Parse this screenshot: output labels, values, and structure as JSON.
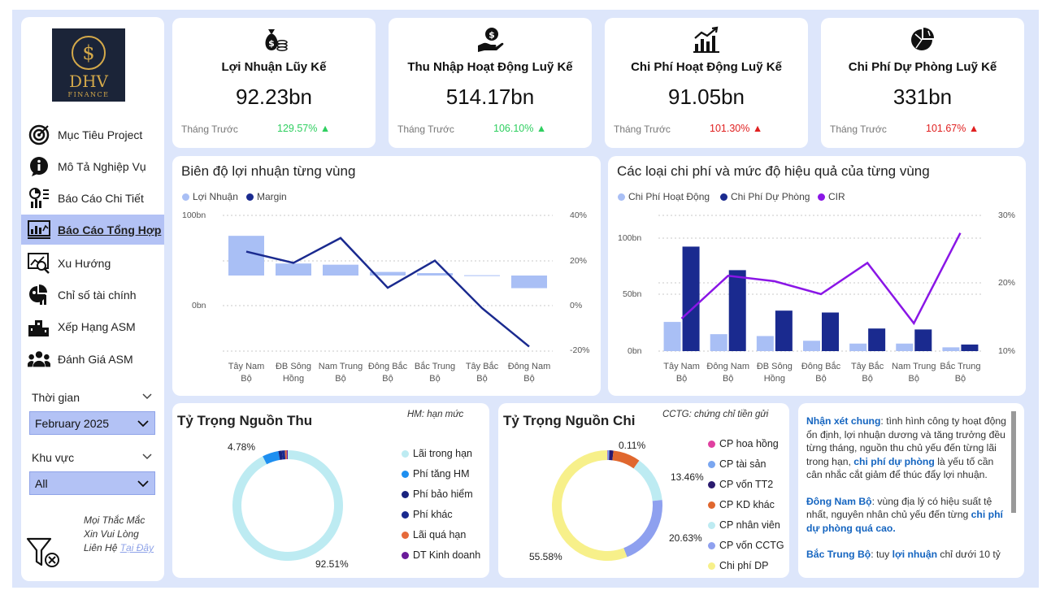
{
  "brand": {
    "logo_text": "DHV",
    "logo_sub": "FINANCE",
    "logo_symbol": "$"
  },
  "nav": [
    {
      "label": "Mục Tiêu Project",
      "icon": "target-icon"
    },
    {
      "label": "Mô Tả Nghiệp Vụ",
      "icon": "info-icon"
    },
    {
      "label": "Báo Cáo Chi Tiết",
      "icon": "detail-report-icon"
    },
    {
      "label": "Báo Cáo Tổng Hợp",
      "icon": "summary-report-icon",
      "active": true
    },
    {
      "label": "Xu Hướng",
      "icon": "trend-icon"
    },
    {
      "label": "Chỉ số tài chính",
      "icon": "finance-index-icon"
    },
    {
      "label": "Xếp Hạng ASM",
      "icon": "ranking-icon"
    },
    {
      "label": "Đánh Giá ASM",
      "icon": "team-icon"
    }
  ],
  "filters": {
    "time": {
      "label": "Thời gian",
      "value": "February 2025"
    },
    "region": {
      "label": "Khu vực",
      "value": "All"
    }
  },
  "contact": {
    "line1": "Mọi Thắc Mắc",
    "line2": "Xin Vui Lòng",
    "line3": "Liên Hệ",
    "link": "Tại Đây"
  },
  "kpis": [
    {
      "title": "Lợi Nhuận Lũy Kế",
      "value": "92.23bn",
      "prev_label": "Tháng Trước",
      "change": "129.57%",
      "arrow": "▲",
      "trend": "up",
      "icon": "money-bag-icon"
    },
    {
      "title": "Thu Nhập Hoạt Động Luỹ Kế",
      "value": "514.17bn",
      "prev_label": "Tháng Trước",
      "change": "106.10%",
      "arrow": "▲",
      "trend": "up",
      "icon": "hand-coin-icon"
    },
    {
      "title": "Chi Phí Hoạt Động Luỹ Kế",
      "value": "91.05bn",
      "prev_label": "Tháng Trước",
      "change": "101.30%",
      "arrow": "▲",
      "trend": "down",
      "icon": "bar-growth-icon"
    },
    {
      "title": "Chi Phí Dự Phòng Luỹ Kế",
      "value": "331bn",
      "prev_label": "Tháng Trước",
      "change": "101.67%",
      "arrow": "▲",
      "trend": "down",
      "icon": "pie-chart-icon"
    }
  ],
  "colors": {
    "light_blue": "#a9bff5",
    "navy": "#1a2a8f",
    "purple": "#8a16e6",
    "up": "#2fcf60",
    "down": "#e02020"
  },
  "chart_data": [
    {
      "type": "bar",
      "title": "Biên độ lợi nhuận từng vùng",
      "categories": [
        "Tây Nam Bộ",
        "ĐB Sông Hồng",
        "Nam Trung Bộ",
        "Đông Bắc Bộ",
        "Bắc Trung Bộ",
        "Tây Bắc Bộ",
        "Đông Nam Bộ"
      ],
      "series": [
        {
          "name": "Lợi Nhuận",
          "type": "bar",
          "values": [
            66,
            20,
            18,
            6,
            4,
            0.5,
            -21
          ]
        },
        {
          "name": "Margin",
          "type": "line",
          "axis": "right",
          "values": [
            24,
            19,
            30,
            8,
            20,
            -1,
            -18
          ]
        }
      ],
      "left_ticks": [
        "100bn",
        "0bn"
      ],
      "ylim": [
        -50,
        100
      ],
      "right_ticks": [
        "40%",
        "20%",
        "0%",
        "-20%"
      ],
      "y2lim": [
        -20,
        40
      ],
      "grid": true,
      "legend": "top-left"
    },
    {
      "type": "bar",
      "title": "Các loại chi phí và mức độ hiệu quả của từng vùng",
      "categories": [
        "Tây Nam Bộ",
        "Đông Nam Bộ",
        "ĐB Sông Hồng",
        "Đông Bắc Bộ",
        "Tây Bắc Bộ",
        "Nam Trung Bộ",
        "Bắc Trung Bộ"
      ],
      "series": [
        {
          "name": "Chi Phí Hoạt Động",
          "type": "bar",
          "values": [
            31,
            18,
            16,
            11,
            8,
            8,
            4
          ]
        },
        {
          "name": "Chi Phí Dự Phòng",
          "type": "bar",
          "values": [
            111,
            86,
            43,
            41,
            24,
            23,
            7
          ]
        },
        {
          "name": "CIR",
          "type": "line",
          "axis": "right",
          "values": [
            14.8,
            21.1,
            20.3,
            18.4,
            23,
            14.1,
            27.4
          ]
        }
      ],
      "left_ticks": [
        "100bn",
        "50bn",
        "0bn"
      ],
      "ylim": [
        0,
        120
      ],
      "right_ticks": [
        "30%",
        "20%",
        "10%"
      ],
      "y2lim": [
        10,
        30
      ],
      "grid": true,
      "legend": "top-left"
    },
    {
      "type": "pie",
      "title": "Tỷ Trọng Nguồn Thu",
      "note": "HM: hạn mức",
      "labels": [
        "Lãi trong hạn",
        "Phí tăng HM",
        "Phí bảo hiểm",
        "Phí khác",
        "Lãi quá hạn",
        "DT Kinh doanh"
      ],
      "values": [
        92.51,
        4.78,
        1.0,
        0.9,
        0.5,
        0.31
      ],
      "colors": [
        "#bdebf2",
        "#1e8ff0",
        "#1a237e",
        "#1a2a8f",
        "#e66a3a",
        "#6a1b9a"
      ],
      "data_labels": [
        {
          "text": "92.51%",
          "slice": 0
        },
        {
          "text": "4.78%",
          "slice": 1
        }
      ]
    },
    {
      "type": "pie",
      "title": "Tỷ Trọng Nguồn Chi",
      "note": "CCTG: chứng chỉ tiền gửi",
      "labels": [
        "CP hoa hồng",
        "CP tài sản",
        "CP vốn TT2",
        "CP KD khác",
        "CP nhân viên",
        "CP vốn CCTG",
        "Chi phí DP"
      ],
      "values": [
        0.11,
        0.5,
        1.2,
        8.0,
        13.46,
        20.63,
        55.58
      ],
      "colors": [
        "#e040a0",
        "#7aa6f0",
        "#2a1a6e",
        "#e0672e",
        "#bdebf2",
        "#8ea0ef",
        "#f7f08a"
      ],
      "data_labels": [
        {
          "text": "0.11%",
          "slice": 0
        },
        {
          "text": "13.46%",
          "slice": 4
        },
        {
          "text": "20.63%",
          "slice": 5
        },
        {
          "text": "55.58%",
          "slice": 6
        }
      ]
    }
  ],
  "charts_text": {
    "c1_l0": "100bn",
    "c1_l1": "0bn",
    "c1_r0": "40%",
    "c1_r1": "20%",
    "c1_r2": "0%",
    "c1_r3": "-20%",
    "c2_l0": "100bn",
    "c2_l1": "50bn",
    "c2_l2": "0bn",
    "c2_r0": "30%",
    "c2_r1": "20%",
    "c2_r2": "10%"
  },
  "comment": {
    "p1_head": "Nhận xét chung",
    "p1_a": ": tình hình công ty hoạt động ổn định, lợi nhuận dương và tăng trưởng đều từng tháng, nguồn thu chủ yếu đến từng lãi trong hạn, ",
    "p1_hl": "chi phí dự phòng",
    "p1_b": " là yếu tố cần cân nhắc cắt giảm để thúc đẩy lợi nhuận.",
    "p2_head": "Đông Nam Bộ",
    "p2_a": ": vùng địa lý có hiệu suất tệ nhất, nguyên nhân chủ yếu đến từng ",
    "p2_hl": "chi phí dự phòng quá cao.",
    "p3_head": "Bắc Trung Bộ",
    "p3_a": ": tuy ",
    "p3_hl": "lợi nhuận",
    "p3_b": " chỉ dưới 10 tỷ"
  }
}
